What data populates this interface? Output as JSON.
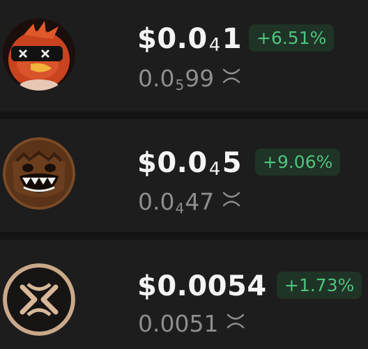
{
  "tokens": [
    {
      "price_main": "$0.0",
      "price_sub": "4",
      "price_tail": "1",
      "change": "+6.51%",
      "native_main": "0.0",
      "native_sub": "5",
      "native_tail": "99",
      "native_icon": "xrp-icon",
      "avatar_icon": "red-bird-sunglasses-avatar"
    },
    {
      "price_main": "$0.0",
      "price_sub": "4",
      "price_tail": "5",
      "change": "+9.06%",
      "native_main": "0.0",
      "native_sub": "4",
      "native_tail": "47",
      "native_icon": "xrp-icon",
      "avatar_icon": "brown-creature-avatar"
    },
    {
      "price_main": "$0.0054",
      "price_sub": "",
      "price_tail": "",
      "change": "+1.73%",
      "native_main": "0.0051",
      "native_sub": "",
      "native_tail": "",
      "native_icon": "xrp-icon",
      "avatar_icon": "gold-monogram-avatar"
    }
  ],
  "colors": {
    "background": "#141414",
    "row": "#1d1d1d",
    "price": "#f4f4f4",
    "secondary": "#8e8e8e",
    "positive": "#4fc47c",
    "positive_bg": "#1f3327"
  }
}
